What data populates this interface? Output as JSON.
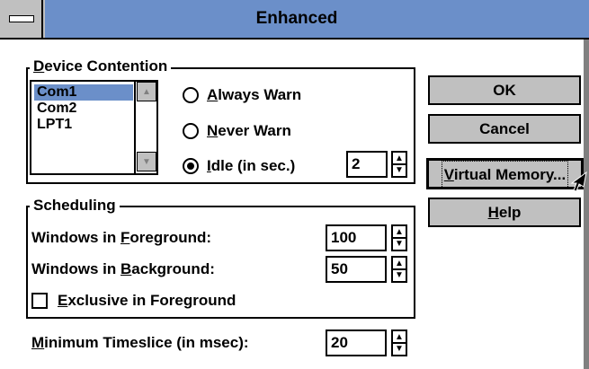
{
  "window": {
    "title": "Enhanced"
  },
  "device_contention": {
    "legend": "Device Contention",
    "legend_mnemonic": "D",
    "legend_rest": "evice Contention",
    "list_items": [
      "Com1",
      "Com2",
      "LPT1"
    ],
    "selected_item": "Com1",
    "options": [
      {
        "mnemonic": "A",
        "rest": "lways Warn",
        "selected": false
      },
      {
        "mnemonic": "N",
        "rest": "ever Warn",
        "selected": false
      },
      {
        "mnemonic": "I",
        "rest": "dle (in sec.)",
        "selected": true
      }
    ],
    "idle_value": "2"
  },
  "scheduling": {
    "legend": "Scheduling",
    "foreground": {
      "prefix": "Windows in ",
      "mnemonic": "F",
      "rest": "oreground:",
      "value": "100"
    },
    "background": {
      "prefix": "Windows in ",
      "mnemonic": "B",
      "rest": "ackground:",
      "value": "50"
    },
    "exclusive": {
      "mnemonic": "E",
      "rest": "xclusive in Foreground",
      "checked": false
    }
  },
  "timeslice": {
    "mnemonic": "M",
    "rest": "inimum Timeslice (in msec):",
    "value": "20"
  },
  "buttons": {
    "ok": "OK",
    "cancel": "Cancel",
    "virtual_memory": {
      "mnemonic": "V",
      "rest": "irtual Memory..."
    },
    "help": {
      "mnemonic": "H",
      "rest": "elp"
    }
  },
  "colors": {
    "title_bar": "#6b8fc9",
    "selection": "#6b8fc9",
    "button_face": "#c0c0c0"
  }
}
